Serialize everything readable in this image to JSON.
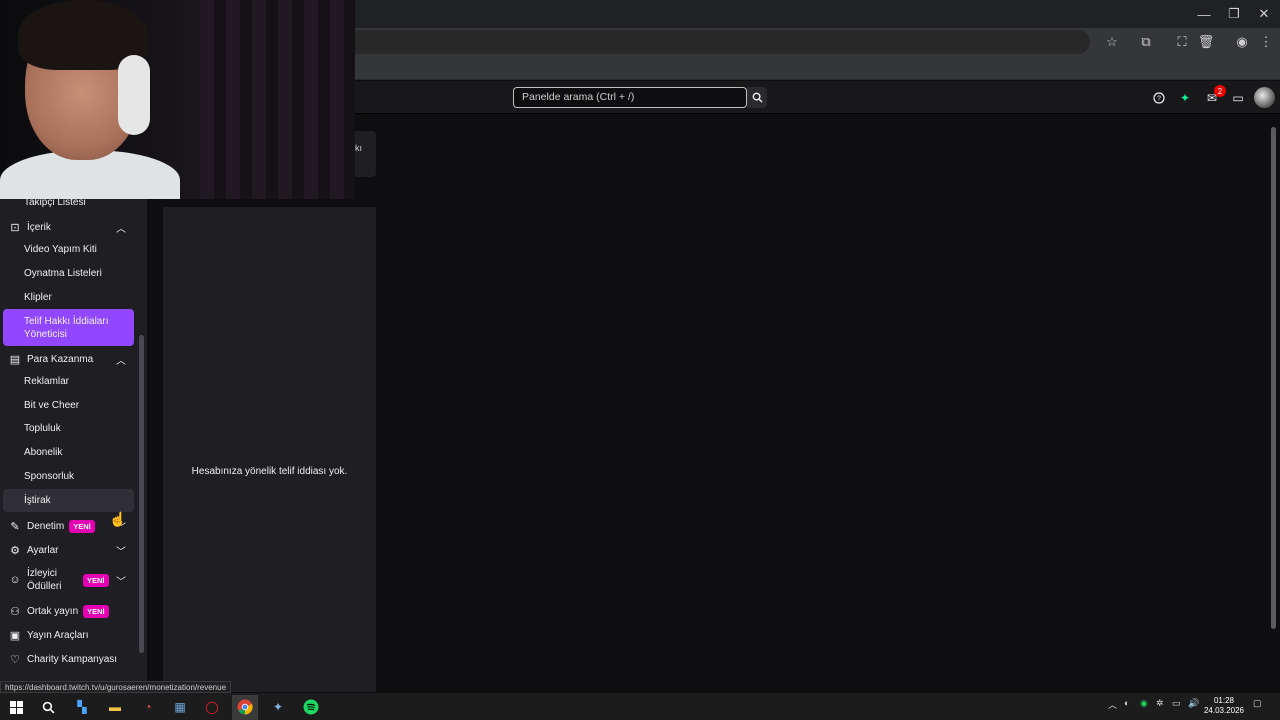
{
  "browser": {
    "controls": [
      "—",
      "❐",
      "✕"
    ],
    "toolbar_icons": [
      "star-icon",
      "extensions-icon",
      "cast-icon",
      "trash-icon",
      "profile-icon",
      "menu-icon"
    ]
  },
  "topnav": {
    "search_placeholder": "Panelde arama (Ctrl + /)",
    "notifications_count": "2"
  },
  "sidebar": {
    "top_item": "Takipçi Listesi",
    "sections": [
      {
        "label": "İçerik",
        "icon": "content-icon",
        "expanded": true,
        "items": [
          "Video Yapım Kiti",
          "Oynatma Listeleri",
          "Klipler",
          "Telif Hakkı İddiaları Yöneticisi"
        ]
      },
      {
        "label": "Para Kazanma",
        "icon": "monetization-icon",
        "expanded": true,
        "items": [
          "Reklamlar",
          "Bit ve Cheer",
          "Topluluk",
          "Abonelik",
          "Sponsorluk",
          "İştirak"
        ]
      },
      {
        "label": "Denetim",
        "badge": "YENİ",
        "icon": "moderation-icon"
      },
      {
        "label": "Ayarlar",
        "icon": "settings-icon"
      },
      {
        "label": "İzleyici Ödülleri",
        "badge": "YENİ",
        "icon": "rewards-icon"
      },
      {
        "label": "Ortak yayın",
        "badge": "YENİ",
        "icon": "collab-icon"
      },
      {
        "label": "Yayın Araçları",
        "icon": "stream-tools-icon"
      },
      {
        "label": "Charity Kampanyası",
        "icon": "charity-icon"
      }
    ],
    "active_item": "Telif Hakkı İddiaları Yöneticisi"
  },
  "main": {
    "panel_top_fragment": "kı",
    "empty_message": "Hesabınıza yönelik telif iddiası yok."
  },
  "status_url": "https://dashboard.twitch.tv/u/gurosaeren/monetization/revenue",
  "taskbar": {
    "time": "01:28",
    "date": "24.03.2026"
  },
  "colors": {
    "accent": "#9147ff",
    "badge_new": "#e600b4",
    "background": "#0e0e10",
    "sidebar": "#1f1f23"
  }
}
